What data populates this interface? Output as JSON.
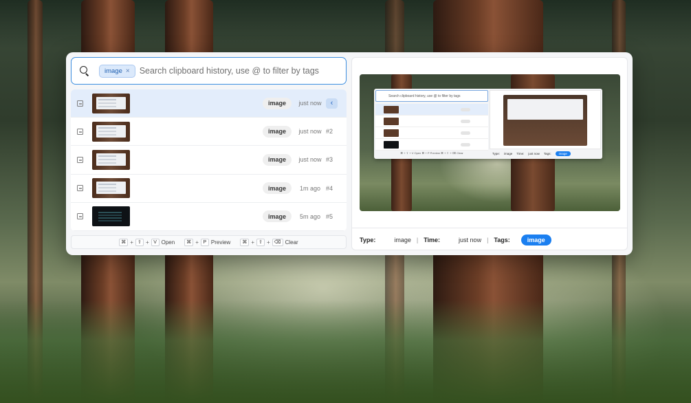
{
  "search": {
    "placeholder": "Search clipboard history, use @ to filter by tags",
    "active_tag": "image",
    "tag_remove_glyph": "×",
    "icon": "search-icon"
  },
  "items": [
    {
      "type": "image",
      "time": "just now",
      "index": "",
      "selected": true,
      "thumb": "light"
    },
    {
      "type": "image",
      "time": "just now",
      "index": "#2",
      "selected": false,
      "thumb": "light"
    },
    {
      "type": "image",
      "time": "just now",
      "index": "#3",
      "selected": false,
      "thumb": "light"
    },
    {
      "type": "image",
      "time": "1m ago",
      "index": "#4",
      "selected": false,
      "thumb": "light"
    },
    {
      "type": "image",
      "time": "5m ago",
      "index": "#5",
      "selected": false,
      "thumb": "dark"
    }
  ],
  "active_indicator": "‹",
  "shortcuts": [
    {
      "keys": [
        "⌘",
        "⇧",
        "V"
      ],
      "label": "Open"
    },
    {
      "keys": [
        "⌘",
        "P"
      ],
      "label": "Preview"
    },
    {
      "keys": [
        "⌘",
        "⇧",
        "⌫"
      ],
      "label": "Clear"
    }
  ],
  "preview": {
    "mini_search": "Search clipboard history, use @ to filter by tags",
    "mini_footer": [
      "Type:",
      "image",
      "Time:",
      "just now",
      "Tags:"
    ],
    "mini_tag": "image",
    "mini_shortcuts": "⌘ + ⇧ + V Open  ⌘ + P Preview  ⌘ + ⇧ + ⌫ Clear"
  },
  "meta": {
    "type_label": "Type:",
    "type_value": "image",
    "time_label": "Time:",
    "time_value": "just now",
    "tags_label": "Tags:",
    "tag_value": "image",
    "separator": "|"
  },
  "colors": {
    "accent": "#1b7ff0",
    "selection": "#e3edfb",
    "border_focus": "#3d8fe0"
  }
}
